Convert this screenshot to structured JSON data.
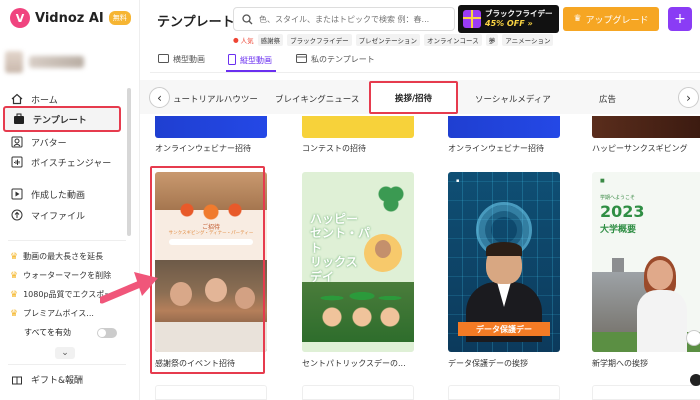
{
  "app": {
    "logo": "Vidnoz AI",
    "badge": "無料",
    "page_title": "テンプレート"
  },
  "search": {
    "placeholder": "色、スタイル、またはトピックで検索 例：春..."
  },
  "promo": {
    "line1": "ブラックフライデー",
    "line2": "45% OFF »"
  },
  "upgrade_label": "アップグレード",
  "hot": {
    "label": "人気",
    "chips": [
      "感謝祭",
      "ブラックフライデー",
      "プレゼンテーション",
      "オンラインコース",
      "夢",
      "アニメーション"
    ]
  },
  "sidebar": {
    "items": [
      {
        "label": "ホーム",
        "icon": "home-icon"
      },
      {
        "label": "テンプレート",
        "icon": "template-icon"
      },
      {
        "label": "アバター",
        "icon": "avatar-icon"
      },
      {
        "label": "ボイスチェンジャー",
        "icon": "voice-icon"
      },
      {
        "label": "作成した動画",
        "icon": "play-icon"
      },
      {
        "label": "マイファイル",
        "icon": "cloud-upload-icon"
      }
    ],
    "perks": [
      "動画の最大長さを延長",
      "ウォーターマークを削除",
      "1080p品質でエクスポート",
      "プレミアムボイス..."
    ],
    "enable_all": "すべてを有効",
    "gift": "ギフト&報酬"
  },
  "orientation_tabs": [
    "横型動画",
    "縦型動画",
    "私のテンプレート"
  ],
  "categories": [
    "ュートリアルハウツー",
    "ブレイキングニュース",
    "挨拶/招待",
    "ソーシャルメディア",
    "広告"
  ],
  "top_row_captions": [
    "オンラインウェビナー招待",
    "コンテストの招待",
    "オンラインウェビナー招待",
    "ハッピーサンクスギビング"
  ],
  "cards": [
    {
      "caption": "感謝祭のイベント招待",
      "text_top": "ご招待",
      "text_sub": "サンクスギビング・ディナー・パーティー"
    },
    {
      "caption": "セントパトリックスデーの...",
      "heading": [
        "ハッピー",
        "セント・パト",
        "リックス",
        "デイ"
      ]
    },
    {
      "caption": "データ保護デーの挨拶",
      "banner": "データ保護デー"
    },
    {
      "caption": "新学期への挨拶",
      "small": "学期へようこそ",
      "year": "2023",
      "sub": "大学概要"
    }
  ],
  "colors": {
    "accent": "#6a2ff0",
    "highlight": "#e63b4e",
    "upgrade": "#f6a623"
  }
}
